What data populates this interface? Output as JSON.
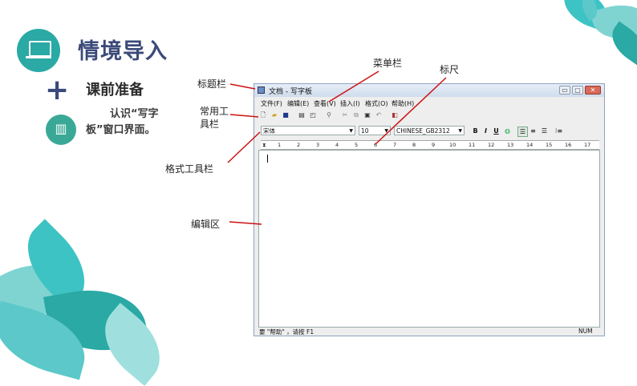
{
  "slide": {
    "title": "情境导入",
    "subtitle": "课前准备",
    "description": "认识“写字板”窗口界面。",
    "icons": {
      "header": "laptop-icon",
      "section": "plus-icon",
      "book": "map-book-icon"
    },
    "colors": {
      "teal": "#2aa9a5",
      "navy": "#3b4a7a",
      "annotation": "#cc1111"
    }
  },
  "annotations": {
    "titlebar": "标题栏",
    "menubar": "菜单栏",
    "ruler": "标尺",
    "toolbar_line1": "常用工",
    "toolbar_line2": "具栏",
    "formatbar": "格式工具栏",
    "editarea": "编辑区"
  },
  "window": {
    "title": "文档 - 写字板",
    "controls": {
      "minimize": "▭",
      "maximize": "▢",
      "close": "✕"
    },
    "menu": [
      "文件(F)",
      "编辑(E)",
      "查看(V)",
      "插入(I)",
      "格式(O)",
      "帮助(H)"
    ],
    "toolbar_icons": [
      "new-icon",
      "open-icon",
      "save-icon",
      "print-icon",
      "print-preview-icon",
      "find-icon",
      "cut-icon",
      "copy-icon",
      "paste-icon",
      "undo-icon",
      "insert-date-icon"
    ],
    "format": {
      "font": "宋体",
      "size": "10",
      "script": "CHINESE_GB2312",
      "bold": "B",
      "italic": "I",
      "underline": "U"
    },
    "ruler_marks": [
      "1",
      "2",
      "3",
      "4",
      "5",
      "6",
      "7",
      "8",
      "9",
      "10",
      "11",
      "12",
      "13",
      "14",
      "15",
      "16",
      "17"
    ],
    "status": {
      "help": "要 \"帮助\" ，请按 F1",
      "num": "NUM"
    }
  }
}
